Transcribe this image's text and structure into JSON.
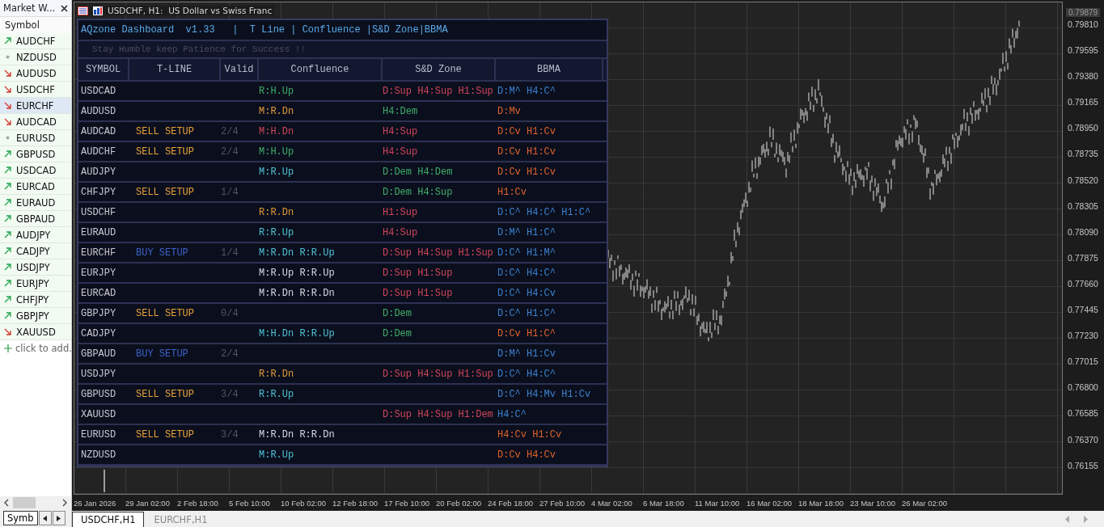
{
  "market_watch": {
    "title": "Market W...",
    "column": "Symbol",
    "items": [
      {
        "symbol": "AUDCHF",
        "kind": "up",
        "selected": false
      },
      {
        "symbol": "NZDUSD",
        "kind": "flat",
        "selected": false
      },
      {
        "symbol": "AUDUSD",
        "kind": "down",
        "selected": false
      },
      {
        "symbol": "USDCHF",
        "kind": "down",
        "selected": false
      },
      {
        "symbol": "EURCHF",
        "kind": "down",
        "selected": true
      },
      {
        "symbol": "AUDCAD",
        "kind": "down",
        "selected": false
      },
      {
        "symbol": "EURUSD",
        "kind": "flat",
        "selected": false
      },
      {
        "symbol": "GBPUSD",
        "kind": "up",
        "selected": false
      },
      {
        "symbol": "USDCAD",
        "kind": "up",
        "selected": false
      },
      {
        "symbol": "EURCAD",
        "kind": "up",
        "selected": false
      },
      {
        "symbol": "EURAUD",
        "kind": "up",
        "selected": false
      },
      {
        "symbol": "GBPAUD",
        "kind": "up",
        "selected": false
      },
      {
        "symbol": "AUDJPY",
        "kind": "up",
        "selected": false
      },
      {
        "symbol": "CADJPY",
        "kind": "up",
        "selected": false
      },
      {
        "symbol": "USDJPY",
        "kind": "up",
        "selected": false
      },
      {
        "symbol": "EURJPY",
        "kind": "up",
        "selected": false
      },
      {
        "symbol": "CHFJPY",
        "kind": "up",
        "selected": false
      },
      {
        "symbol": "GBPJPY",
        "kind": "up",
        "selected": false
      },
      {
        "symbol": "XAUUSD",
        "kind": "down",
        "selected": false
      }
    ],
    "add_row": "click to add.",
    "tab": "Symb"
  },
  "chart": {
    "title": "USDCHF, H1:  US Dollar vs Swiss Franc",
    "price_tag": "0.79879",
    "price_labels": [
      "0.79810",
      "0.79595",
      "0.79380",
      "0.79165",
      "0.78950",
      "0.78735",
      "0.78520",
      "0.78305",
      "0.78090",
      "0.77875",
      "0.77660",
      "0.77445",
      "0.77230",
      "0.77015",
      "0.76800",
      "0.76585",
      "0.76370",
      "0.76155"
    ],
    "time_labels": [
      "26 Jan 2026",
      "29 Jan 02:00",
      "2 Feb 18:00",
      "5 Feb 10:00",
      "10 Feb 02:00",
      "12 Feb 18:00",
      "17 Feb 10:00",
      "20 Feb 02:00",
      "24 Feb 18:00",
      "27 Feb 10:00",
      "4 Mar 02:00",
      "6 Mar 18:00",
      "11 Mar 10:00",
      "16 Mar 02:00",
      "18 Mar 18:00",
      "23 Mar 10:00",
      "26 Mar 02:00"
    ]
  },
  "dashboard": {
    "title": "AQzone Dashboard  v1.33   |  T Line | Confluence |S&D Zone|BBMA",
    "subtitle": "Stay Humble keep Patience for Success !!",
    "columns": [
      "SYMBOL",
      "T-LINE",
      "Valid",
      "Confluence",
      "S&D Zone",
      "BBMA"
    ],
    "rows": [
      {
        "symbol": "USDCAD",
        "confluence": {
          "text": "R:H.Up",
          "color": "#3fae6a"
        },
        "sd_zone": {
          "text": "D:Sup H4:Sup H1:Sup",
          "color": "#d0455a"
        },
        "bbma": {
          "text": "D:M^ H4:C^",
          "color": "#3b82d0"
        }
      },
      {
        "symbol": "AUDUSD",
        "confluence": {
          "text": "M:R.Dn",
          "color": "#e39a3c"
        },
        "sd_zone": {
          "text": "H4:Dem",
          "color": "#3fae6a"
        },
        "bbma": {
          "text": "D:Mv",
          "color": "#e0622c"
        }
      },
      {
        "symbol": "AUDCAD",
        "t_line": {
          "text": "SELL SETUP",
          "color": "#e8a23a"
        },
        "valid": "2/4",
        "confluence": {
          "text": "M:H.Dn",
          "color": "#d0455a"
        },
        "sd_zone": {
          "text": "H4:Sup",
          "color": "#d0455a"
        },
        "bbma": {
          "text": "D:Cv H1:Cv",
          "color": "#e0622c"
        }
      },
      {
        "symbol": "AUDCHF",
        "t_line": {
          "text": "SELL SETUP",
          "color": "#e8a23a"
        },
        "valid": "2/4",
        "confluence": {
          "text": "M:H.Up",
          "color": "#3fae6a"
        },
        "sd_zone": {
          "text": "H4:Sup",
          "color": "#d0455a"
        },
        "bbma": {
          "text": "D:Cv H1:Cv",
          "color": "#e0622c"
        }
      },
      {
        "symbol": "AUDJPY",
        "confluence": {
          "text": "M:R.Up",
          "color": "#4fc1d6"
        },
        "sd_zone": {
          "text": "D:Dem H4:Dem",
          "color": "#3fae6a"
        },
        "bbma": {
          "text": "D:Cv H1:Cv",
          "color": "#e0622c"
        }
      },
      {
        "symbol": "CHFJPY",
        "t_line": {
          "text": "SELL SETUP",
          "color": "#e8a23a"
        },
        "valid": "1/4",
        "sd_zone": {
          "text": "D:Dem H4:Sup",
          "color": "#3fae6a"
        },
        "bbma": {
          "text": "H1:Cv",
          "color": "#e0622c"
        }
      },
      {
        "symbol": "USDCHF",
        "confluence": {
          "text": "R:R.Dn",
          "color": "#e39a3c"
        },
        "sd_zone": {
          "text": "H1:Sup",
          "color": "#d0455a"
        },
        "bbma": {
          "text": "D:C^ H4:C^ H1:C^",
          "color": "#3b82d0"
        }
      },
      {
        "symbol": "EURAUD",
        "confluence": {
          "text": "R:R.Up",
          "color": "#4fc1d6"
        },
        "sd_zone": {
          "text": "H4:Sup",
          "color": "#d0455a"
        },
        "bbma": {
          "text": "D:M^ H1:C^",
          "color": "#3b82d0"
        }
      },
      {
        "symbol": "EURCHF",
        "t_line": {
          "text": "BUY SETUP",
          "color": "#3b63c9"
        },
        "valid": "1/4",
        "confluence": {
          "text": "M:R.Dn R:R.Up",
          "color": "#4fc1d6"
        },
        "sd_zone": {
          "text": "D:Sup H4:Sup H1:Sup",
          "color": "#d0455a"
        },
        "bbma": {
          "text": "D:C^ H1:M^",
          "color": "#3b82d0"
        }
      },
      {
        "symbol": "EURJPY",
        "confluence": {
          "text": "M:R.Up R:R.Up",
          "color": "#d8d8e0"
        },
        "sd_zone": {
          "text": "D:Sup H1:Sup",
          "color": "#d0455a"
        },
        "bbma": {
          "text": "D:C^ H4:C^",
          "color": "#3b82d0"
        }
      },
      {
        "symbol": "EURCAD",
        "confluence": {
          "text": "M:R.Dn R:R.Dn",
          "color": "#d8d8e0"
        },
        "sd_zone": {
          "text": "D:Sup H1:Sup",
          "color": "#d0455a"
        },
        "bbma": {
          "text": "D:C^ H4:Cv",
          "color": "#3b82d0"
        }
      },
      {
        "symbol": "GBPJPY",
        "t_line": {
          "text": "SELL SETUP",
          "color": "#e8a23a"
        },
        "valid": "0/4",
        "sd_zone": {
          "text": "D:Dem",
          "color": "#3fae6a"
        },
        "bbma": {
          "text": "D:C^ H1:C^",
          "color": "#3b82d0"
        }
      },
      {
        "symbol": "CADJPY",
        "confluence": {
          "text": "M:H.Dn R:R.Up",
          "color": "#4fc1d6"
        },
        "sd_zone": {
          "text": "D:Dem",
          "color": "#3fae6a"
        },
        "bbma": {
          "text": "D:Cv H1:C^",
          "color": "#e0622c"
        }
      },
      {
        "symbol": "GBPAUD",
        "t_line": {
          "text": "BUY SETUP",
          "color": "#3b63c9"
        },
        "valid": "2/4",
        "bbma": {
          "text": "D:M^ H1:Cv",
          "color": "#3b82d0"
        }
      },
      {
        "symbol": "USDJPY",
        "confluence": {
          "text": "R:R.Dn",
          "color": "#e39a3c"
        },
        "sd_zone": {
          "text": "D:Sup H4:Sup H1:Sup",
          "color": "#d0455a"
        },
        "bbma": {
          "text": "D:C^ H4:C^",
          "color": "#3b82d0"
        }
      },
      {
        "symbol": "GBPUSD",
        "t_line": {
          "text": "SELL SETUP",
          "color": "#e8a23a"
        },
        "valid": "3/4",
        "confluence": {
          "text": "R:R.Up",
          "color": "#4fc1d6"
        },
        "bbma": {
          "text": "D:C^ H4:Mv H1:Cv",
          "color": "#3b82d0"
        }
      },
      {
        "symbol": "XAUUSD",
        "sd_zone": {
          "text": "D:Sup H4:Sup H1:Dem",
          "color": "#d0455a"
        },
        "bbma": {
          "text": "H4:C^",
          "color": "#3b82d0"
        }
      },
      {
        "symbol": "EURUSD",
        "t_line": {
          "text": "SELL SETUP",
          "color": "#e8a23a"
        },
        "valid": "3/4",
        "confluence": {
          "text": "M:R.Dn R:R.Dn",
          "color": "#d8d8e0"
        },
        "bbma": {
          "text": "H4:Cv H1:Cv",
          "color": "#e0622c"
        }
      },
      {
        "symbol": "NZDUSD",
        "confluence": {
          "text": "M:R.Up",
          "color": "#4fc1d6"
        },
        "bbma": {
          "text": "D:Cv H4:Cv",
          "color": "#e0622c"
        }
      }
    ]
  },
  "chart_tabs": [
    {
      "label": "USDCHF,H1",
      "selected": true
    },
    {
      "label": "EURCHF,H1",
      "selected": false
    }
  ]
}
